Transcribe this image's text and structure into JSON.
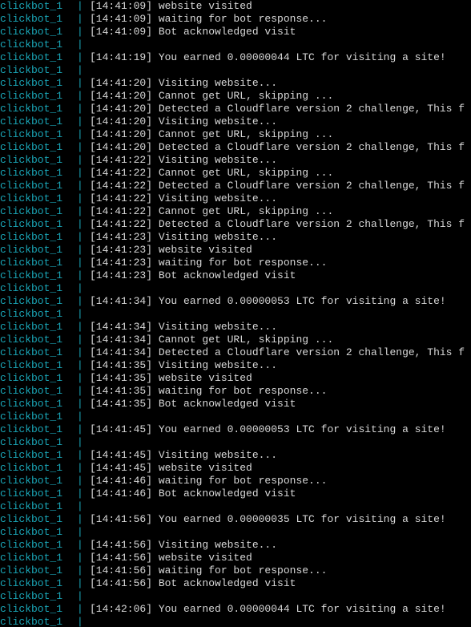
{
  "colors": {
    "background": "#000000",
    "service_name": "#1AA6B7",
    "separator": "#1AA6B7",
    "message": "#D8D8D8"
  },
  "terminal": {
    "lines": [
      {
        "service": "clickbot_1",
        "sep": "|",
        "message": "[14:41:09] website visited"
      },
      {
        "service": "clickbot_1",
        "sep": "|",
        "message": "[14:41:09] waiting for bot response..."
      },
      {
        "service": "clickbot_1",
        "sep": "|",
        "message": "[14:41:09] Bot acknowledged visit"
      },
      {
        "service": "clickbot_1",
        "sep": "|",
        "message": ""
      },
      {
        "service": "clickbot_1",
        "sep": "|",
        "message": "[14:41:19] You earned 0.00000044 LTC for visiting a site!"
      },
      {
        "service": "clickbot_1",
        "sep": "|",
        "message": ""
      },
      {
        "service": "clickbot_1",
        "sep": "|",
        "message": "[14:41:20] Visiting website..."
      },
      {
        "service": "clickbot_1",
        "sep": "|",
        "message": "[14:41:20] Cannot get URL, skipping ..."
      },
      {
        "service": "clickbot_1",
        "sep": "|",
        "message": "[14:41:20] Detected a Cloudflare version 2 challenge, This f"
      },
      {
        "service": "clickbot_1",
        "sep": "|",
        "message": "[14:41:20] Visiting website..."
      },
      {
        "service": "clickbot_1",
        "sep": "|",
        "message": "[14:41:20] Cannot get URL, skipping ..."
      },
      {
        "service": "clickbot_1",
        "sep": "|",
        "message": "[14:41:20] Detected a Cloudflare version 2 challenge, This f"
      },
      {
        "service": "clickbot_1",
        "sep": "|",
        "message": "[14:41:22] Visiting website..."
      },
      {
        "service": "clickbot_1",
        "sep": "|",
        "message": "[14:41:22] Cannot get URL, skipping ..."
      },
      {
        "service": "clickbot_1",
        "sep": "|",
        "message": "[14:41:22] Detected a Cloudflare version 2 challenge, This f"
      },
      {
        "service": "clickbot_1",
        "sep": "|",
        "message": "[14:41:22] Visiting website..."
      },
      {
        "service": "clickbot_1",
        "sep": "|",
        "message": "[14:41:22] Cannot get URL, skipping ..."
      },
      {
        "service": "clickbot_1",
        "sep": "|",
        "message": "[14:41:22] Detected a Cloudflare version 2 challenge, This f"
      },
      {
        "service": "clickbot_1",
        "sep": "|",
        "message": "[14:41:23] Visiting website..."
      },
      {
        "service": "clickbot_1",
        "sep": "|",
        "message": "[14:41:23] website visited"
      },
      {
        "service": "clickbot_1",
        "sep": "|",
        "message": "[14:41:23] waiting for bot response..."
      },
      {
        "service": "clickbot_1",
        "sep": "|",
        "message": "[14:41:23] Bot acknowledged visit"
      },
      {
        "service": "clickbot_1",
        "sep": "|",
        "message": ""
      },
      {
        "service": "clickbot_1",
        "sep": "|",
        "message": "[14:41:34] You earned 0.00000053 LTC for visiting a site!"
      },
      {
        "service": "clickbot_1",
        "sep": "|",
        "message": ""
      },
      {
        "service": "clickbot_1",
        "sep": "|",
        "message": "[14:41:34] Visiting website..."
      },
      {
        "service": "clickbot_1",
        "sep": "|",
        "message": "[14:41:34] Cannot get URL, skipping ..."
      },
      {
        "service": "clickbot_1",
        "sep": "|",
        "message": "[14:41:34] Detected a Cloudflare version 2 challenge, This f"
      },
      {
        "service": "clickbot_1",
        "sep": "|",
        "message": "[14:41:35] Visiting website..."
      },
      {
        "service": "clickbot_1",
        "sep": "|",
        "message": "[14:41:35] website visited"
      },
      {
        "service": "clickbot_1",
        "sep": "|",
        "message": "[14:41:35] waiting for bot response..."
      },
      {
        "service": "clickbot_1",
        "sep": "|",
        "message": "[14:41:35] Bot acknowledged visit"
      },
      {
        "service": "clickbot_1",
        "sep": "|",
        "message": ""
      },
      {
        "service": "clickbot_1",
        "sep": "|",
        "message": "[14:41:45] You earned 0.00000053 LTC for visiting a site!"
      },
      {
        "service": "clickbot_1",
        "sep": "|",
        "message": ""
      },
      {
        "service": "clickbot_1",
        "sep": "|",
        "message": "[14:41:45] Visiting website..."
      },
      {
        "service": "clickbot_1",
        "sep": "|",
        "message": "[14:41:45] website visited"
      },
      {
        "service": "clickbot_1",
        "sep": "|",
        "message": "[14:41:46] waiting for bot response..."
      },
      {
        "service": "clickbot_1",
        "sep": "|",
        "message": "[14:41:46] Bot acknowledged visit"
      },
      {
        "service": "clickbot_1",
        "sep": "|",
        "message": ""
      },
      {
        "service": "clickbot_1",
        "sep": "|",
        "message": "[14:41:56] You earned 0.00000035 LTC for visiting a site!"
      },
      {
        "service": "clickbot_1",
        "sep": "|",
        "message": ""
      },
      {
        "service": "clickbot_1",
        "sep": "|",
        "message": "[14:41:56] Visiting website..."
      },
      {
        "service": "clickbot_1",
        "sep": "|",
        "message": "[14:41:56] website visited"
      },
      {
        "service": "clickbot_1",
        "sep": "|",
        "message": "[14:41:56] waiting for bot response..."
      },
      {
        "service": "clickbot_1",
        "sep": "|",
        "message": "[14:41:56] Bot acknowledged visit"
      },
      {
        "service": "clickbot_1",
        "sep": "|",
        "message": ""
      },
      {
        "service": "clickbot_1",
        "sep": "|",
        "message": "[14:42:06] You earned 0.00000044 LTC for visiting a site!"
      },
      {
        "service": "clickbot_1",
        "sep": "|",
        "message": ""
      }
    ]
  }
}
